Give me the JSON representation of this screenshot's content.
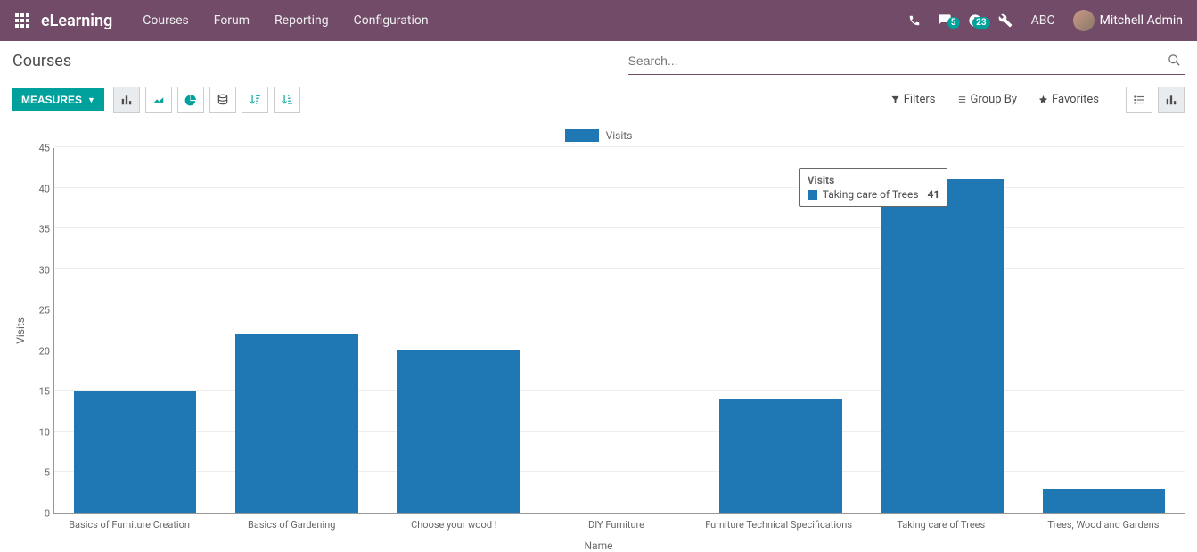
{
  "app": {
    "brand": "eLearning",
    "nav": [
      "Courses",
      "Forum",
      "Reporting",
      "Configuration"
    ],
    "badges": {
      "messages": "5",
      "activities": "23"
    },
    "debug_label": "ABC",
    "user_name": "Mitchell Admin"
  },
  "page": {
    "title": "Courses"
  },
  "search": {
    "placeholder": "Search..."
  },
  "toolbar": {
    "measures_label": "MEASURES",
    "filters_label": "Filters",
    "groupby_label": "Group By",
    "favorites_label": "Favorites"
  },
  "legend": {
    "series_label": "Visits"
  },
  "tooltip": {
    "title": "Visits",
    "category": "Taking care of Trees",
    "value": "41"
  },
  "chart_data": {
    "type": "bar",
    "title": "",
    "xlabel": "Name",
    "ylabel": "Visits",
    "ylim": [
      0,
      45
    ],
    "yticks": [
      0,
      5,
      10,
      15,
      20,
      25,
      30,
      35,
      40,
      45
    ],
    "categories": [
      "Basics of Furniture Creation",
      "Basics of Gardening",
      "Choose your wood !",
      "DIY Furniture",
      "Furniture Technical Specifications",
      "Taking care of Trees",
      "Trees, Wood and Gardens"
    ],
    "values": [
      15,
      22,
      20,
      0,
      14,
      41,
      3
    ],
    "series": [
      {
        "name": "Visits",
        "values": [
          15,
          22,
          20,
          0,
          14,
          41,
          3
        ]
      }
    ],
    "colors": {
      "bar": "#1f77b4"
    }
  }
}
